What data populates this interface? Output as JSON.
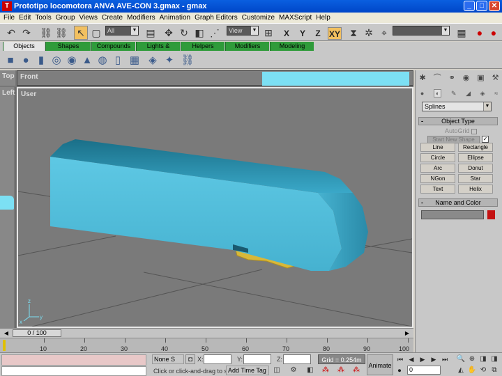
{
  "window": {
    "title": "Prototipo locomotora ANVA AVE-CON 3.gmax - gmax",
    "minimize": "_",
    "maximize": "□",
    "close": "✕"
  },
  "menu": [
    "File",
    "Edit",
    "Tools",
    "Group",
    "Views",
    "Create",
    "Modifiers",
    "Animation",
    "Graph Editors",
    "Customize",
    "MAXScript",
    "Help"
  ],
  "toolbar": {
    "selection_filter": "All",
    "reference_coord": "View",
    "axes": [
      "X",
      "Y",
      "Z",
      "XY"
    ],
    "named_selection": ""
  },
  "tabs": [
    "Objects",
    "Shapes",
    "Compounds",
    "Lights & Cameras",
    "Helpers",
    "Modifiers",
    "Modeling"
  ],
  "active_tab": "Objects",
  "viewports": {
    "top_label": "Top",
    "front_label": "Front",
    "left_label": "Left",
    "user_label": "User"
  },
  "command_panel": {
    "category": "Splines",
    "object_type_title": "Object Type",
    "autogrid": "AutoGrid",
    "start_new_shape": "Start New Shape",
    "buttons": [
      "Line",
      "Rectangle",
      "Circle",
      "Ellipse",
      "Arc",
      "Donut",
      "NGon",
      "Star",
      "Text",
      "Helix"
    ],
    "name_color_title": "Name and Color",
    "name_value": "",
    "color": "#c41212"
  },
  "time": {
    "slider_label": "0 / 100",
    "ticks": [
      "10",
      "20",
      "30",
      "40",
      "50",
      "60",
      "70",
      "80",
      "90",
      "100"
    ]
  },
  "status": {
    "selection": "None S",
    "x_label": "X:",
    "y_label": "Y:",
    "z_label": "Z:",
    "x_value": "",
    "y_value": "",
    "z_value": "",
    "grid": "Grid = 0.254m",
    "prompt": "Click or click-and-drag to selec",
    "add_time_tag": "Add Time Tag",
    "animate": "Animate",
    "frame": "0"
  },
  "colors": {
    "train_body": "#4fb8d4",
    "bogie": "#d8b83a",
    "viewport_bg": "#7a7a7a",
    "tab_green": "#2f9b3a",
    "active_highlight": "#f2c060"
  }
}
